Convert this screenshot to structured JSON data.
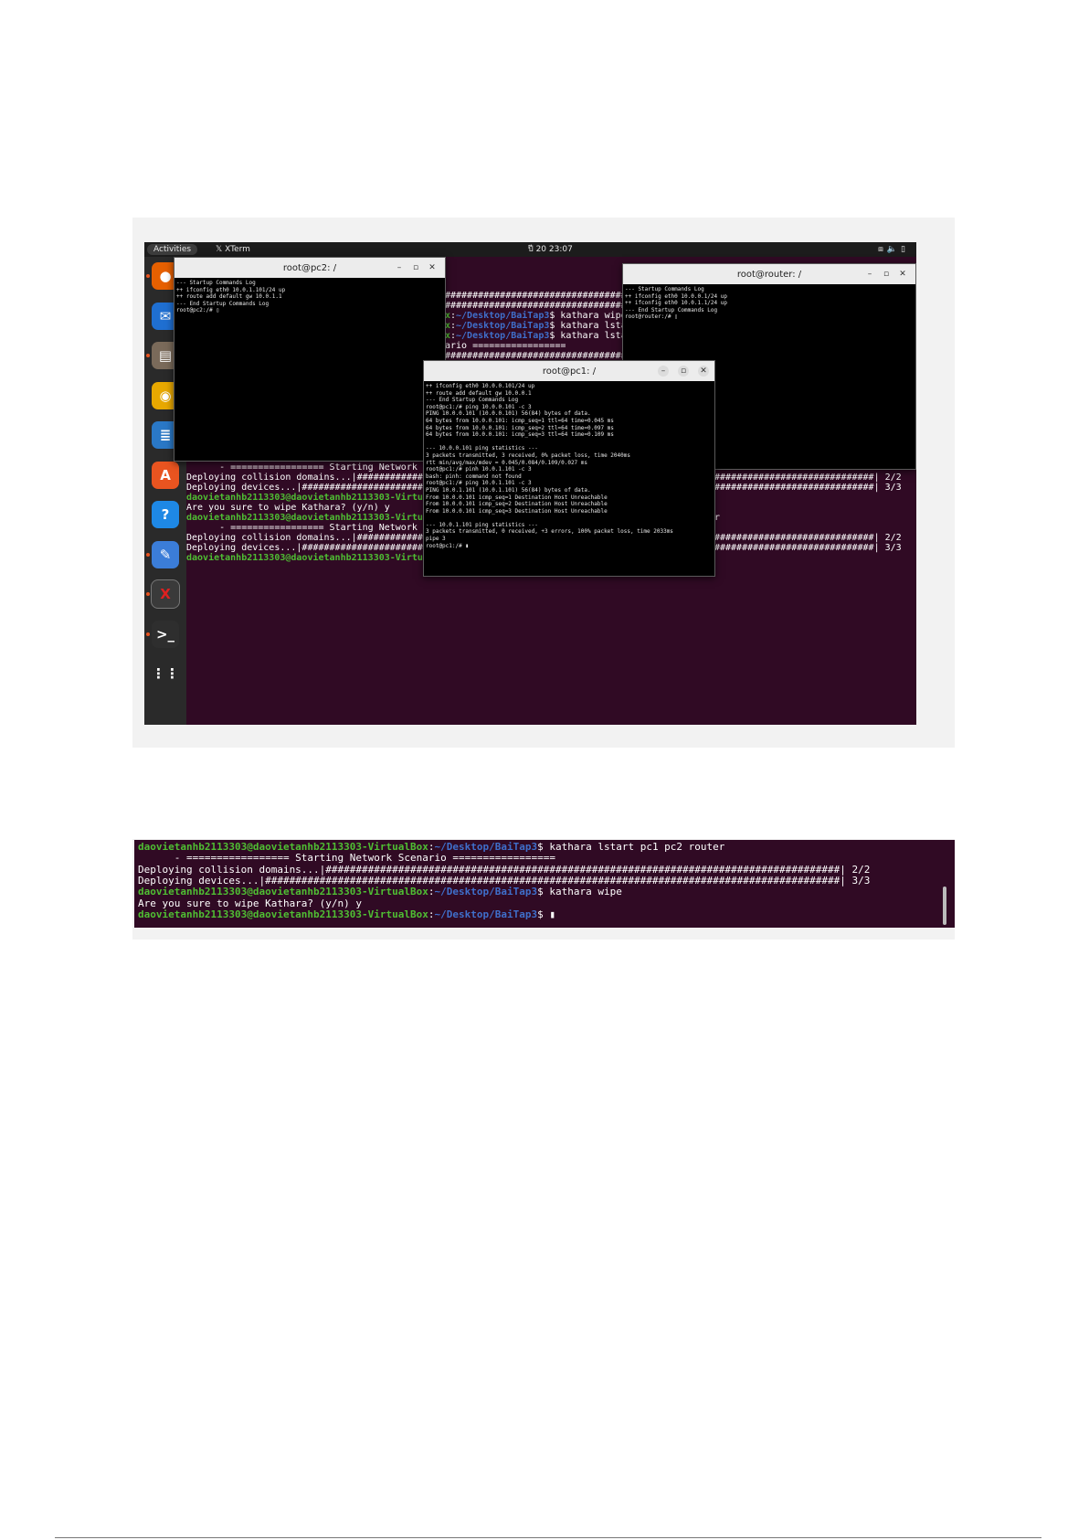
{
  "screenshot1": {
    "topbar": {
      "activities": "Activities",
      "app_name": "XTerm",
      "clock": "ปี 20  23:07"
    },
    "dock": {
      "items": [
        "firefox-icon",
        "thunderbird-icon",
        "files-icon",
        "rhythmbox-icon",
        "writer-icon",
        "app-center-icon",
        "help-icon",
        "text-editor-icon",
        "xterm-icon",
        "terminal-icon",
        "show-apps-icon"
      ]
    },
    "bg_terminal": {
      "prompt_user": "daovietanhb2113303@daovietanhb2113303-VirtualBox",
      "prompt_path": "~/Desktop/BaiTap3",
      "lines": [
        {
          "kind": "text",
          "text": "       ================="
        },
        {
          "kind": "text",
          "text": "       ################################################################################"
        },
        {
          "kind": "text",
          "text": "       ################################################################################"
        },
        {
          "kind": "prompt",
          "text": "$ kathara wipe"
        },
        {
          "kind": "prompt",
          "text": "$ kathara lsta"
        },
        {
          "kind": "prompt",
          "text": "$ kathara lstart pc1 pc2 router"
        },
        {
          "kind": "text",
          "text": "      - ================= Starting Network Scenario ================="
        },
        {
          "kind": "text",
          "text": "Deploying collision domains...|##############################################################################################| 2/2"
        },
        {
          "kind": "text",
          "text": "Deploying devices...|########################################################################################################| 3/3"
        },
        {
          "kind": "prompt",
          "text": "$ kathara wipe"
        },
        {
          "kind": "text",
          "text": "Are you sure to wipe Kathara? (y/n) y"
        },
        {
          "kind": "prompt",
          "text": "$ kathara lstart pc1 pc2 router"
        },
        {
          "kind": "text",
          "text": "      - ================= Starting Network Scenario ================="
        },
        {
          "kind": "text",
          "text": "Deploying collision domains...|##############################################################################################| 2/2"
        },
        {
          "kind": "text",
          "text": "Deploying devices...|########################################################################################################| 3/3"
        },
        {
          "kind": "prompt",
          "text": "$ kathara wipe"
        },
        {
          "kind": "text",
          "text": "Are you sure to wipe Kathara? (y/n) y"
        },
        {
          "kind": "prompt",
          "text": "$ kathara lstart pc1 pc2 router"
        },
        {
          "kind": "text",
          "text": "      - ================= Starting Network Scenario ================="
        },
        {
          "kind": "text",
          "text": "Deploying collision domains...|##############################################################################################| 2/2"
        },
        {
          "kind": "text",
          "text": "Deploying devices...|########################################################################################################| 3/3"
        },
        {
          "kind": "prompt",
          "text": "$ kathara wipe"
        },
        {
          "kind": "text",
          "text": "Are you sure to wipe Kathara? (y/n) y"
        },
        {
          "kind": "prompt",
          "text": "$ kathara lstart pc1 pc2 router"
        },
        {
          "kind": "text",
          "text": "      - ================= Starting Network Scenario ================="
        },
        {
          "kind": "text",
          "text": "Deploying collision domains...|##############################################################################################| 2/2"
        },
        {
          "kind": "text",
          "text": "Deploying devices...|########################################################################################################| 3/3"
        },
        {
          "kind": "prompt",
          "text": "$ "
        }
      ]
    },
    "windows": {
      "pc2": {
        "title": "root@pc2: /",
        "lines": [
          "--- Startup Commands Log",
          "++ ifconfig eth0 10.0.1.101/24 up",
          "++ route add default gw 10.0.1.1",
          "--- End Startup Commands Log",
          "root@pc2:/# ▯"
        ]
      },
      "router": {
        "title": "root@router: /",
        "lines": [
          "--- Startup Commands Log",
          "++ ifconfig eth0 10.0.0.1/24 up",
          "++ ifconfig eth0 10.0.1.1/24 up",
          "--- End Startup Commands Log",
          "root@router:/# ▯"
        ]
      },
      "pc1": {
        "title": "root@pc1: /",
        "lines": [
          "++ ifconfig eth0 10.0.0.101/24 up",
          "++ route add default gw 10.0.0.1",
          "--- End Startup Commands Log",
          "root@pc1:/# ping 10.0.0.101 -c 3",
          "PING 10.0.0.101 (10.0.0.101) 56(84) bytes of data.",
          "64 bytes from 10.0.0.101: icmp_seq=1 ttl=64 time=0.045 ms",
          "64 bytes from 10.0.0.101: icmp_seq=2 ttl=64 time=0.097 ms",
          "64 bytes from 10.0.0.101: icmp_seq=3 ttl=64 time=0.109 ms",
          "",
          "--- 10.0.0.101 ping statistics ---",
          "3 packets transmitted, 3 received, 0% packet loss, time 2040ms",
          "rtt min/avg/max/mdev = 0.045/0.084/0.109/0.027 ms",
          "root@pc1:/# pinh 10.0.1.101 -c 3",
          "bash: pinh: command not found",
          "root@pc1:/# ping 10.0.1.101 -c 3",
          "PING 10.0.1.101 (10.0.1.101) 56(84) bytes of data.",
          "From 10.0.0.101 icmp_seq=1 Destination Host Unreachable",
          "From 10.0.0.101 icmp_seq=2 Destination Host Unreachable",
          "From 10.0.0.101 icmp_seq=3 Destination Host Unreachable",
          "",
          "--- 10.0.1.101 ping statistics ---",
          "3 packets transmitted, 0 received, +3 errors, 100% packet loss, time 2033ms",
          "pipe 3",
          "root@pc1:/# ▮"
        ]
      }
    },
    "colors": {
      "terminal_bg": "#300a24",
      "prompt_user": "#4fbe33",
      "prompt_path": "#3f6fcb"
    }
  },
  "screenshot2": {
    "prompt_user": "daovietanhb2113303@daovietanhb2113303-VirtualBox",
    "prompt_path": "~/Desktop/BaiTap3",
    "lines": [
      {
        "kind": "prompt",
        "text": "$ kathara lstart pc1 pc2 router"
      },
      {
        "kind": "text",
        "text": "      - ================= Starting Network Scenario ================="
      },
      {
        "kind": "text",
        "text": "Deploying collision domains...|#####################################################################################| 2/2"
      },
      {
        "kind": "text",
        "text": "Deploying devices...|###############################################################################################| 3/3"
      },
      {
        "kind": "prompt",
        "text": "$ kathara wipe"
      },
      {
        "kind": "text",
        "text": "Are you sure to wipe Kathara? (y/n) y"
      },
      {
        "kind": "prompt",
        "text": "$ ▮"
      }
    ]
  }
}
